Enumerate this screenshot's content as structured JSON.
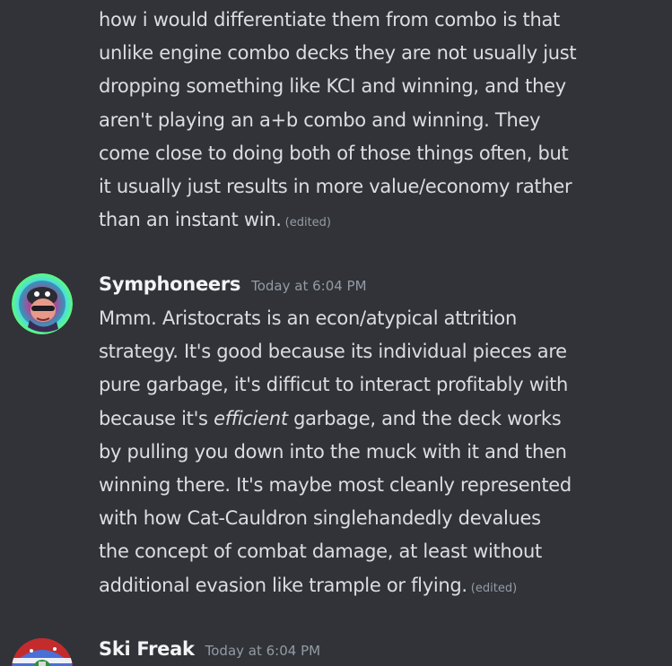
{
  "messages": [
    {
      "lines": [
        "how i would differentiate them from combo is that",
        "unlike engine combo decks they are not usually just",
        "dropping something like KCI and winning, and they",
        "aren't playing an a+b combo and winning. They",
        "come close to doing both of those things often, but",
        "it usually just results in more value/economy rather",
        "than an instant win."
      ],
      "edited": "(edited)"
    },
    {
      "author": "Symphoneers",
      "timestamp": "Today at 6:04 PM",
      "avatar_icon": "colorful-character-avatar",
      "lines": [
        {
          "text": "Mmm. Aristocrats is an econ/atypical attrition"
        },
        {
          "text": "strategy. It's good because its individual pieces are"
        },
        {
          "text": "pure garbage, it's difficut to interact profitably with"
        },
        {
          "pre": "because it's ",
          "em": "efficient",
          "post": " garbage, and the deck works"
        },
        {
          "text": "by pulling you down into the muck with it and then"
        },
        {
          "text": "winning there. It's maybe most cleanly represented"
        },
        {
          "text": "with how Cat-Cauldron singlehandedly devalues"
        },
        {
          "text": "the concept of combat damage, at least without"
        },
        {
          "text": "additional evasion like trample or flying."
        }
      ],
      "edited": "(edited)"
    },
    {
      "author": "Ski Freak",
      "timestamp": "Today at 6:04 PM",
      "avatar_icon": "christmas-avatar"
    }
  ],
  "colors": {
    "background": "#313338",
    "text": "#dbdee1",
    "muted": "#949ba4",
    "username": "#f2f3f5"
  }
}
